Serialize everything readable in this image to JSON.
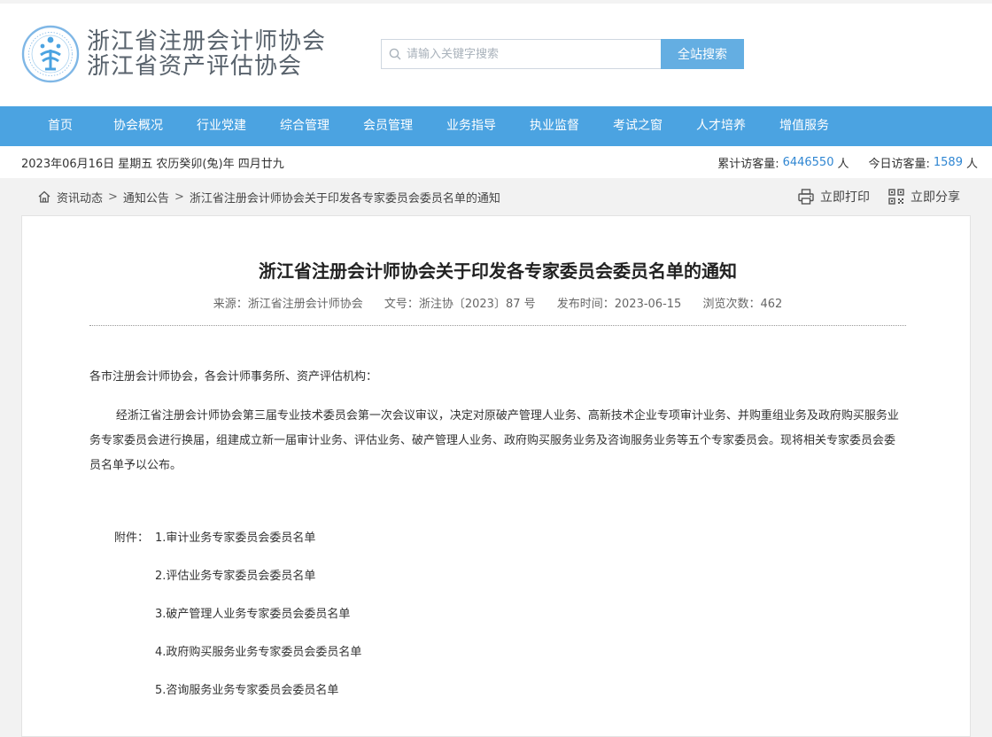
{
  "header": {
    "logo_line1": "浙江省注册会计师协会",
    "logo_line2": "浙江省资产评估协会",
    "search_placeholder": "请输入关键字搜索",
    "search_button": "全站搜索"
  },
  "colors": {
    "nav_bg": "#4ba3e1",
    "search_button_bg": "#64aee2",
    "visit_number": "#2f86d2",
    "logo_text": "#58626c"
  },
  "nav": {
    "items": [
      "首页",
      "协会概况",
      "行业党建",
      "综合管理",
      "会员管理",
      "业务指导",
      "执业监督",
      "考试之窗",
      "人才培养",
      "增值服务"
    ]
  },
  "info": {
    "date": "2023年06月16日 星期五 农历癸卯(兔)年 四月廿九",
    "total_label": "累计访客量:",
    "total_value": "6446550",
    "total_unit": "人",
    "today_label": "今日访客量:",
    "today_value": "1589",
    "today_unit": "人"
  },
  "breadcrumb": {
    "items": [
      "资讯动态",
      "通知公告",
      "浙江省注册会计师协会关于印发各专家委员会委员名单的通知"
    ],
    "separator": ">",
    "print": "立即打印",
    "share": "立即分享"
  },
  "article": {
    "title": "浙江省注册会计师协会关于印发各专家委员会委员名单的通知",
    "source": "来源：浙江省注册会计师协会",
    "doc_no": "文号：浙注协〔2023〕87 号",
    "publish_time": "发布时间：2023-06-15",
    "views": "浏览次数：462",
    "greeting": "各市注册会计师协会，各会计师事务所、资产评估机构：",
    "body": "经浙江省注册会计师协会第三届专业技术委员会第一次会议审议，决定对原破产管理人业务、高新技术企业专项审计业务、并购重组业务及政府购买服务业务专家委员会进行换届，组建成立新一届审计业务、评估业务、破产管理人业务、政府购买服务业务及咨询服务业务等五个专家委员会。现将相关专家委员会委员名单予以公布。",
    "attachment_label": "附件：",
    "attachments": [
      "1.审计业务专家委员会委员名单",
      "2.评估业务专家委员会委员名单",
      "3.破产管理人业务专家委员会委员名单",
      "4.政府购买服务业务专家委员会委员名单",
      "5.咨询服务业务专家委员会委员名单"
    ]
  },
  "icons": {
    "logo": "association-emblem-icon",
    "search": "search-icon",
    "home": "home-icon",
    "print": "printer-icon",
    "share": "qrcode-icon"
  }
}
